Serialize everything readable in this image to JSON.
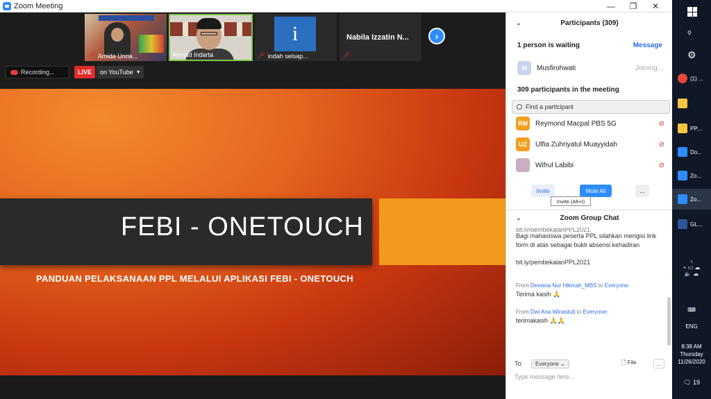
{
  "window": {
    "title": "Zoom Meeting",
    "minimize": "—",
    "restore": "❐",
    "close": "✕"
  },
  "tiles": [
    {
      "name": "Arnida Unria..."
    },
    {
      "name": "Ahmad Indarta"
    },
    {
      "name": "indah selsap...",
      "glyph": "i"
    },
    {
      "name": "Nabila Izzatin N..."
    }
  ],
  "recording": {
    "label": "Recording..."
  },
  "live": {
    "badge": "LIVE",
    "target": "on YouTube"
  },
  "slide": {
    "headline": "FEBI - ONETOUCH",
    "subtitle": "PANDUAN PELAKSANAAN PPL MELALUI APLIKASI FEBI - ONETOUCH",
    "colors": {
      "band": "#2a2a2a",
      "accent": "#f3991d",
      "bg": "#e5641e"
    }
  },
  "participants": {
    "header": "Participants (309)",
    "waiting_label": "1 person is waiting",
    "message_link": "Message",
    "waiting_person": {
      "initial": "M",
      "name": "Musfirohwati",
      "status": "Joining..."
    },
    "count_label": "309 participants in the meeting",
    "search_placeholder": "Find a participant",
    "list": [
      {
        "initials": "RM",
        "name": "Reymond Macpal PBS 5G",
        "color": "#f0a020"
      },
      {
        "initials": "UZ",
        "name": "Ulfia Zuhriyatul Muayyidah",
        "color": "#f0a020"
      },
      {
        "initials": "",
        "name": "Wifrul Labibi",
        "color": "#c9b0c0"
      }
    ],
    "invite": "Invite",
    "mute_all": "Mute All",
    "more": "...",
    "tooltip": "Invite (Alt+I)"
  },
  "chat": {
    "header": "Zoom Group Chat",
    "cut_line": "bit.ly/pembekalanPPL2021",
    "message1": "Bagi mahasiswa peserta PPL silahkan mengisi link form di atas sebagai bukti absensi kehadiran",
    "link": "bit.ly/pembekalanPPL2021",
    "entries": [
      {
        "from_prefix": "From",
        "sender": "Deviana Nur Hikmah_MBS",
        "to_word": "to",
        "recipient": "Everyone:",
        "text": "Terima kasih 🙏"
      },
      {
        "from_prefix": "From",
        "sender": "Dwi Ana Winastuti",
        "to_word": "to",
        "recipient": "Everyone:",
        "text": "terimakasih 🙏🙏"
      }
    ],
    "to_label": "To:",
    "to_value": "Everyone",
    "file_label": "File",
    "more": "...",
    "placeholder": "Type message here..."
  },
  "taskbar": {
    "items": [
      {
        "label": "(1) ...",
        "color": "#e8453c"
      },
      {
        "label": "",
        "color": "#f5c542"
      },
      {
        "label": "PP...",
        "color": "#f5c542"
      },
      {
        "label": "Do...",
        "color": "#2d8cff"
      },
      {
        "label": "Zo...",
        "color": "#2d8cff"
      },
      {
        "label": "Zo...",
        "color": "#2d8cff"
      },
      {
        "label": "GL...",
        "color": "#2b579a"
      }
    ],
    "lang": "ENG",
    "time": "8:38 AM",
    "day": "Thursday",
    "date": "11/26/2020",
    "notif_count": "19"
  }
}
